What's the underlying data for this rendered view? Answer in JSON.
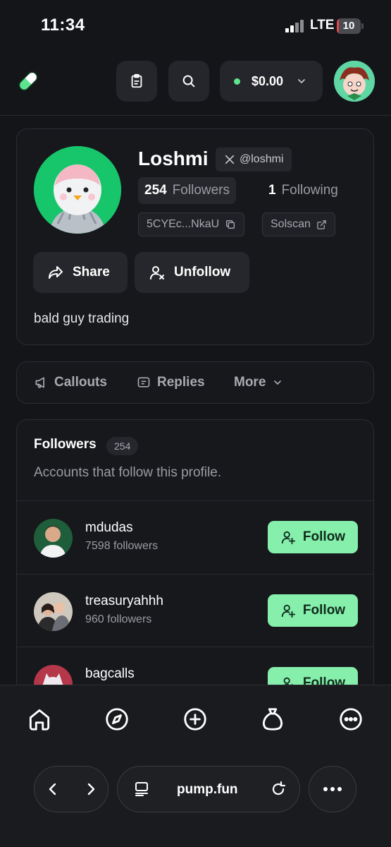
{
  "status_bar": {
    "time": "11:34",
    "network": "LTE",
    "battery": "10"
  },
  "wallet": {
    "balance": "$0.00"
  },
  "profile": {
    "name": "Loshmi",
    "x_handle": "@loshmi",
    "followers_count": "254",
    "followers_label": "Followers",
    "following_count": "1",
    "following_label": "Following",
    "address": "5CYEc...NkaU",
    "solscan_label": "Solscan",
    "share_label": "Share",
    "unfollow_label": "Unfollow",
    "bio": "bald guy trading"
  },
  "tabs": [
    {
      "label": "Callouts"
    },
    {
      "label": "Replies"
    },
    {
      "label": "More"
    }
  ],
  "followers_section": {
    "title": "Followers",
    "count": "254",
    "subtitle": "Accounts that follow this profile.",
    "rows": [
      {
        "name": "mdudas",
        "followers": "7598 followers",
        "button": "Follow"
      },
      {
        "name": "treasuryahhh",
        "followers": "960 followers",
        "button": "Follow"
      },
      {
        "name": "bagcalls",
        "followers": "",
        "button": "Follow"
      }
    ]
  },
  "browser": {
    "url": "pump.fun"
  },
  "colors": {
    "accent": "#86efac",
    "background": "#141519",
    "card": "#17181c",
    "status_dot": "#5ee38e"
  },
  "icons": [
    "pill-logo-icon",
    "clipboard-icon",
    "search-icon",
    "chevron-down-icon",
    "x-logo-icon",
    "copy-icon",
    "external-link-icon",
    "share-arrow-icon",
    "user-x-icon",
    "megaphone-icon",
    "message-icon",
    "user-plus-icon",
    "home-icon",
    "compass-icon",
    "plus-circle-icon",
    "money-bag-icon",
    "more-circle-icon",
    "back-icon",
    "forward-icon",
    "tabs-icon",
    "reload-icon",
    "ellipsis-icon"
  ]
}
